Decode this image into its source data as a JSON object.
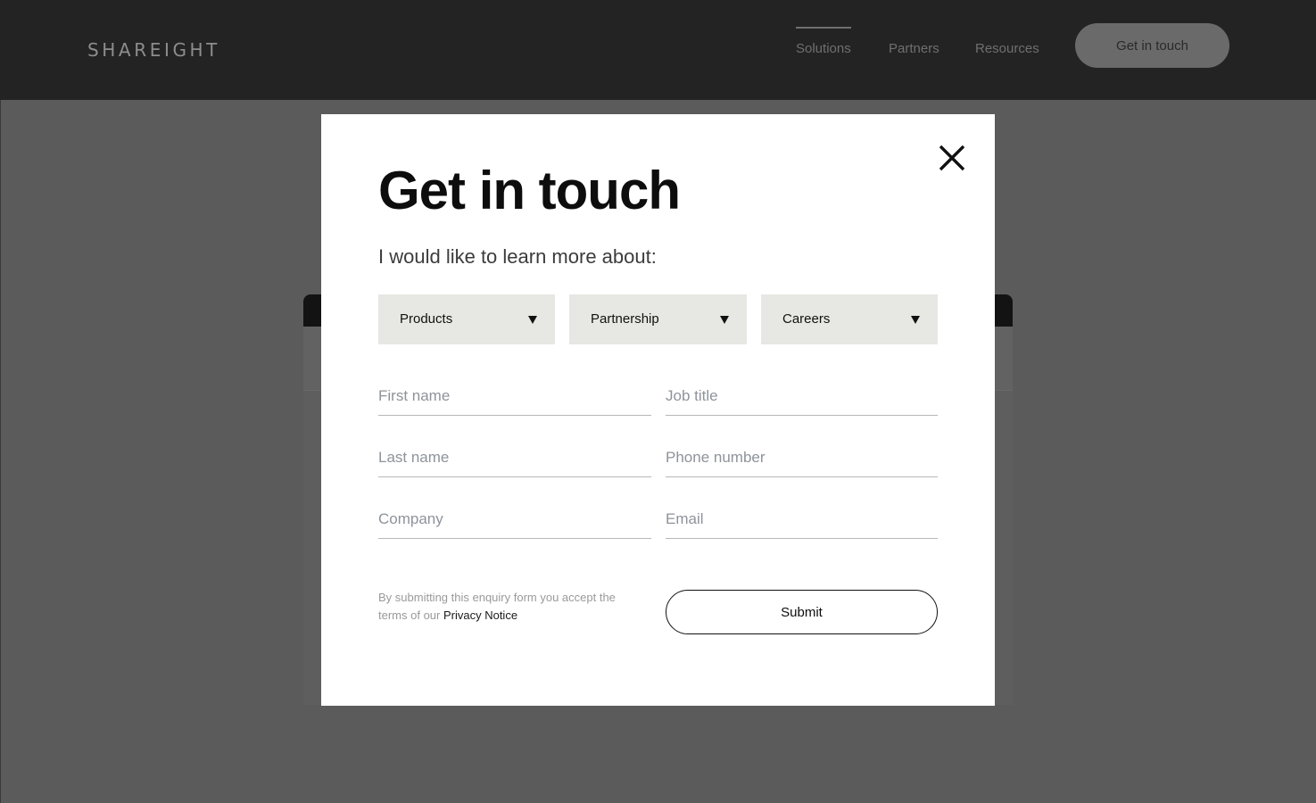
{
  "header": {
    "logo": "SHAREIGHT",
    "nav": [
      {
        "label": "Solutions",
        "active": true
      },
      {
        "label": "Partners",
        "active": false
      },
      {
        "label": "Resources",
        "active": false
      }
    ],
    "cta_label": "Get in touch"
  },
  "modal": {
    "title": "Get in touch",
    "subtitle": "I would like to learn more about:",
    "selects": [
      {
        "label": "Products"
      },
      {
        "label": "Partnership"
      },
      {
        "label": "Careers"
      }
    ],
    "fields": {
      "first_name": {
        "placeholder": "First name",
        "value": ""
      },
      "job_title": {
        "placeholder": "Job title",
        "value": ""
      },
      "last_name": {
        "placeholder": "Last name",
        "value": ""
      },
      "phone_number": {
        "placeholder": "Phone number",
        "value": ""
      },
      "company": {
        "placeholder": "Company",
        "value": ""
      },
      "email": {
        "placeholder": "Email",
        "value": ""
      }
    },
    "disclaimer_text": "By submitting this enquiry form you accept the terms of our ",
    "privacy_link_label": "Privacy Notice",
    "submit_label": "Submit"
  },
  "icons": {
    "close": "close-icon",
    "caret": "caret-down-icon"
  },
  "colors": {
    "header_bg": "#232323",
    "overlay_bg": "#5b5b5b",
    "select_bg": "#e7e7e3",
    "text_dark": "#0d0d0d"
  }
}
